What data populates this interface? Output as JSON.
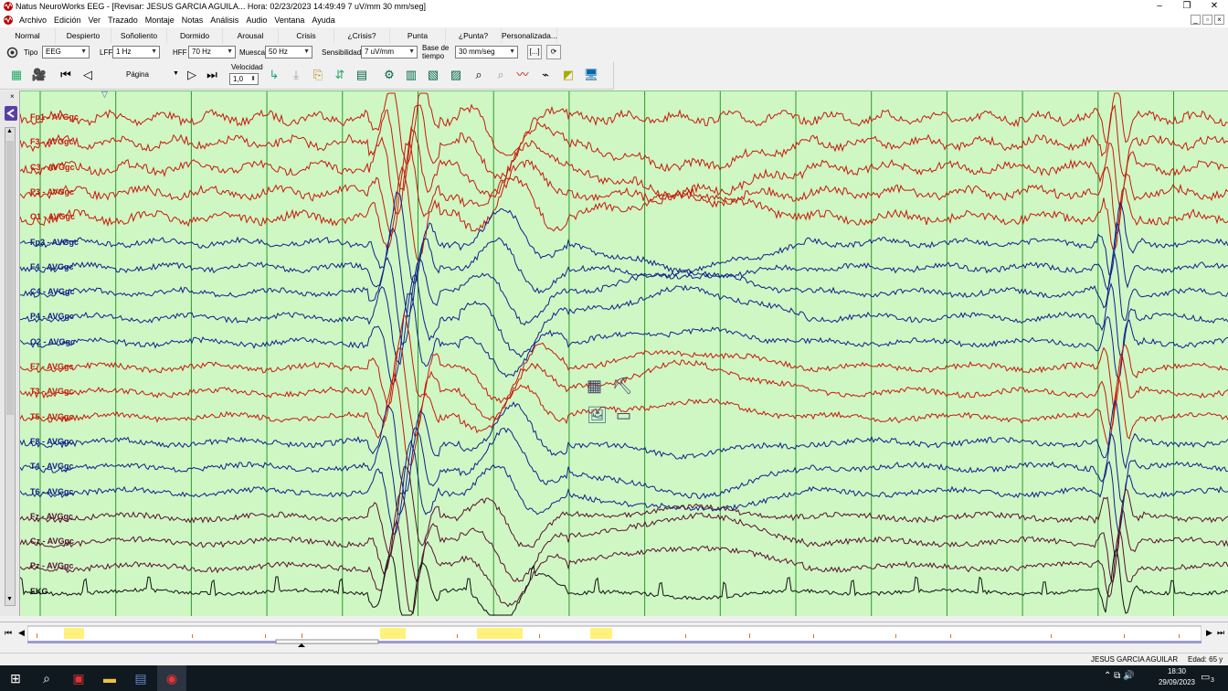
{
  "window": {
    "title": "Natus NeuroWorks EEG - [Revisar:  JESUS  GARCIA AGUILA...  Hora: 02/23/2023 14:49:49  7 uV/mm  30 mm/seg]",
    "minimize": "–",
    "restore": "❐",
    "close": "✕"
  },
  "menu": [
    "Archivo",
    "Edición",
    "Ver",
    "Trazado",
    "Montaje",
    "Notas",
    "Análisis",
    "Audio",
    "Ventana",
    "Ayuda"
  ],
  "presets": [
    "Normal",
    "Despierto",
    "Soñoliento",
    "Dormido",
    "Arousal",
    "Crisis",
    "¿Crisis?",
    "Punta",
    "¿Punta?",
    "Personalizada..."
  ],
  "controls": {
    "tipo_label": "Tipo",
    "tipo_value": "EEG",
    "lff_label": "LFF",
    "lff_value": "1 Hz",
    "hff_label": "HFF",
    "hff_value": "70 Hz",
    "muesca_label": "Muesca",
    "muesca_value": "50 Hz",
    "sens_label": "Sensibilidad",
    "sens_value": "7 uV/mm",
    "base_label_1": "Base de",
    "base_label_2": "tiempo",
    "base_value": "30 mm/seg",
    "bracket_btn": "[...]",
    "refresh_btn": "⟳"
  },
  "navigation": {
    "pagina_label": "Página",
    "velocidad_label": "Velocidad",
    "velocidad_value": "1,0"
  },
  "channels": [
    {
      "label": "Fp1 - AVGgc",
      "color": "#c8190a"
    },
    {
      "label": "F3 - AVGgc",
      "color": "#c8190a"
    },
    {
      "label": "C3 - AVGgc",
      "color": "#c8190a"
    },
    {
      "label": "P3 - AVGgc",
      "color": "#c8190a"
    },
    {
      "label": "O1 - AVGgc",
      "color": "#c8190a"
    },
    {
      "label": "Fp2 - AVGgc",
      "color": "#10208c"
    },
    {
      "label": "F4 - AVGgc",
      "color": "#10208c"
    },
    {
      "label": "C4 - AVGgc",
      "color": "#10208c"
    },
    {
      "label": "P4 - AVGgc",
      "color": "#10208c"
    },
    {
      "label": "O2 - AVGgc",
      "color": "#10208c"
    },
    {
      "label": "F7 - AVGgc",
      "color": "#c8190a"
    },
    {
      "label": "T3 - AVGgc",
      "color": "#c8190a"
    },
    {
      "label": "T5 - AVGgc",
      "color": "#c8190a"
    },
    {
      "label": "F8 - AVGgc",
      "color": "#10208c"
    },
    {
      "label": "T4 - AVGgc",
      "color": "#10208c"
    },
    {
      "label": "T6 - AVGgc",
      "color": "#10208c"
    },
    {
      "label": "Fz - AVGgc",
      "color": "#5a1030"
    },
    {
      "label": "Cz - AVGgc",
      "color": "#5a1030"
    },
    {
      "label": "Pz - AVGgc",
      "color": "#5a1030"
    },
    {
      "label": "EKG",
      "color": "#111111"
    }
  ],
  "colors": {
    "background": "#cff7c4",
    "gridline": "#2a9a2a",
    "left_hemisphere": "#c8190a",
    "right_hemisphere": "#10208c",
    "midline": "#5a1030",
    "ekg": "#111111",
    "timeline_marker": "#fff27a"
  },
  "status": {
    "patient": "JESUS  GARCIA AGUILAR",
    "age": "Edad: 65 y"
  },
  "taskbar": {
    "time": "18:30",
    "date": "29/09/2023",
    "notifications": "3"
  }
}
